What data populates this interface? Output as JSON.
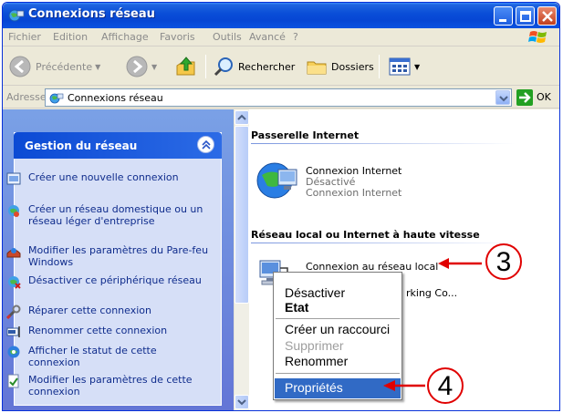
{
  "window": {
    "title": "Connexions réseau"
  },
  "menu": [
    "Fichier",
    "Edition",
    "Affichage",
    "Favoris",
    "Outils",
    "Avancé",
    "?"
  ],
  "toolbar": {
    "back": "Précédente",
    "search": "Rechercher",
    "folders": "Dossiers"
  },
  "address": {
    "label": "Adresse",
    "value": "Connexions réseau",
    "go": "OK"
  },
  "taskpane": {
    "title": "Gestion du réseau",
    "tasks": [
      {
        "label": "Créer une nouvelle connexion",
        "icon": "new-connection-icon"
      },
      {
        "label": "Créer un réseau domestique ou un réseau léger d'entreprise",
        "icon": "home-network-icon"
      },
      {
        "label": "Modifier les paramètres du Pare-feu Windows",
        "icon": "firewall-icon"
      },
      {
        "label": "Désactiver ce périphérique réseau",
        "icon": "disable-device-icon"
      },
      {
        "label": "Réparer cette connexion",
        "icon": "repair-icon"
      },
      {
        "label": "Renommer cette connexion",
        "icon": "rename-icon"
      },
      {
        "label": "Afficher le statut de cette connexion",
        "icon": "status-icon"
      },
      {
        "label": "Modifier les paramètres de cette connexion",
        "icon": "settings-icon"
      }
    ]
  },
  "groups": {
    "internet_gateway": {
      "title": "Passerelle Internet",
      "item": {
        "name": "Connexion Internet",
        "status": "Désactivé",
        "type": "Connexion Internet"
      }
    },
    "lan": {
      "title": "Réseau local ou Internet à haute vitesse",
      "item": {
        "name": "Connexion au réseau local",
        "device_partial": "rking Co..."
      }
    }
  },
  "context_menu": {
    "items": [
      {
        "label": "Désactiver",
        "state": "normal"
      },
      {
        "label": "Etat",
        "state": "bold"
      },
      {
        "label": "Créer un raccourci",
        "state": "normal"
      },
      {
        "label": "Supprimer",
        "state": "disabled"
      },
      {
        "label": "Renommer",
        "state": "normal"
      },
      {
        "label": "Propriétés",
        "state": "selected"
      }
    ]
  },
  "annotations": {
    "step3": "3",
    "step4": "4"
  },
  "colors": {
    "title_bar": "#0a4fd8",
    "selection": "#316ac5",
    "callout": "#e00000",
    "task_link": "#0f2c8c"
  }
}
